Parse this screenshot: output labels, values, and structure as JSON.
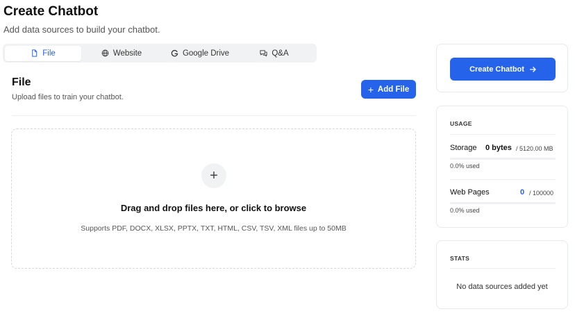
{
  "header": {
    "title": "Create Chatbot",
    "subtitle": "Add data sources to build your chatbot."
  },
  "tabs": [
    {
      "label": "File",
      "icon": "file-icon",
      "active": true
    },
    {
      "label": "Website",
      "icon": "globe-icon",
      "active": false
    },
    {
      "label": "Google Drive",
      "icon": "google-icon",
      "active": false
    },
    {
      "label": "Q&A",
      "icon": "chat-icon",
      "active": false
    }
  ],
  "section": {
    "title": "File",
    "subtitle": "Upload files to train your chatbot.",
    "add_button": "Add File",
    "add_icon": "plus-icon"
  },
  "dropzone": {
    "icon": "plus-icon",
    "title": "Drag and drop files here, or click to browse",
    "hint": "Supports PDF, DOCX, XLSX, PPTX, TXT, HTML, CSV, TSV, XML files up to 50MB"
  },
  "sidebar": {
    "create_button": "Create Chatbot",
    "create_icon": "arrow-right-icon",
    "usage": {
      "heading": "USAGE",
      "storage": {
        "label": "Storage",
        "value": "0 bytes",
        "max": "/ 5120.00 MB",
        "used": "0.0% used",
        "fraction": 0.0
      },
      "web_pages": {
        "label": "Web Pages",
        "value": "0",
        "max": "/ 100000",
        "used": "0.0% used",
        "fraction": 0.0
      }
    },
    "stats": {
      "heading": "STATS",
      "empty": "No data sources added yet"
    }
  },
  "colors": {
    "accent": "#2563eb",
    "tab_bg": "#f1f2f4",
    "border": "#e7e9ec"
  }
}
